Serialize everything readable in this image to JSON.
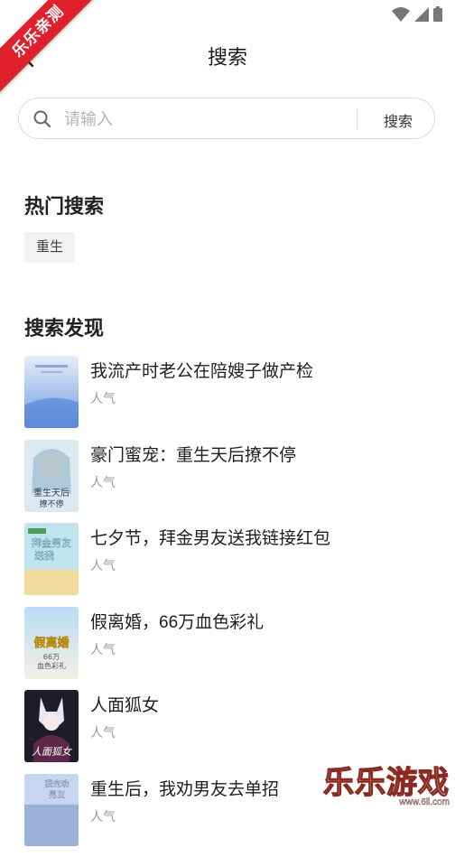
{
  "ribbon": {
    "text": "乐乐亲测"
  },
  "header": {
    "title": "搜索"
  },
  "search": {
    "placeholder": "请输入",
    "value": "",
    "button_label": "搜索"
  },
  "hot": {
    "title": "热门搜索",
    "tags": [
      "重生"
    ]
  },
  "discover": {
    "title": "搜索发现",
    "books": [
      {
        "title": "我流产时老公在陪嫂子做产检",
        "tag": "人气",
        "cover_color": "#cfe0f5",
        "cover_text": ""
      },
      {
        "title": "豪门蜜宠：重生天后撩不停",
        "tag": "人气",
        "cover_color": "#d6e8ef",
        "cover_text": "重生天后撩不停"
      },
      {
        "title": "七夕节，拜金男友送我链接红包",
        "tag": "人气",
        "cover_color": "#bde3ee",
        "cover_text": "拜金男友送我"
      },
      {
        "title": "假离婚，66万血色彩礼",
        "tag": "人气",
        "cover_color": "#d7ecf6",
        "cover_text": "66万血色彩礼"
      },
      {
        "title": "人面狐女",
        "tag": "人气",
        "cover_color": "#2a2a3a",
        "cover_text": "人面狐女"
      },
      {
        "title": "重生后，我劝男友去单招",
        "tag": "人气",
        "cover_color": "#c8d8f0",
        "cover_text": "我去劝男友单招"
      }
    ]
  },
  "watermark": {
    "text": "乐乐游戏",
    "url": "www.6ll.com"
  }
}
